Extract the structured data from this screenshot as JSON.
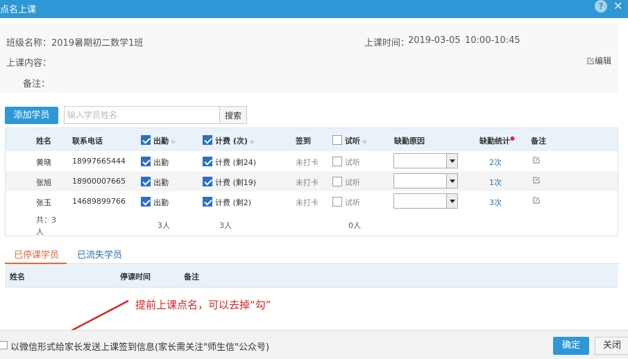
{
  "dialog": {
    "title": "点名上课",
    "help": "?",
    "close": "✕"
  },
  "info": {
    "class_label": "班级名称：",
    "class_name": "2019暑期初二数学1班",
    "time_label": "上课时间：",
    "date": "2019-03-05",
    "time": "10:00-10:45",
    "content_label": "上课内容：",
    "edit_label": "编辑",
    "note_label": "备注："
  },
  "toolbar": {
    "add_label": "添加学员",
    "search_placeholder": "输入学员姓名",
    "search_label": "搜索"
  },
  "table": {
    "headers": {
      "name": "姓名",
      "phone": "联系电话",
      "attend": "出勤",
      "charge": "计费 (次)",
      "sign": "签到",
      "trial": "试听",
      "reason": "缺勤原因",
      "absent": "缺勤统计",
      "note": "备注"
    },
    "rows": [
      {
        "name": "黄晓",
        "phone": "18997665444",
        "attend": "出勤",
        "attend_checked": true,
        "charge": "计费 (剩24)",
        "charge_checked": true,
        "sign": "未打卡",
        "trial": "试听",
        "trial_checked": false,
        "absent": "2次"
      },
      {
        "name": "张旭",
        "phone": "18900007665",
        "attend": "出勤",
        "attend_checked": true,
        "charge": "计费 (剩19)",
        "charge_checked": true,
        "sign": "未打卡",
        "trial": "试听",
        "trial_checked": false,
        "absent": "1次"
      },
      {
        "name": "张玉",
        "phone": "14689899766",
        "attend": "出勤",
        "attend_checked": true,
        "charge": "计费 (剩2)",
        "charge_checked": true,
        "sign": "未打卡",
        "trial": "试听",
        "trial_checked": false,
        "absent": "3次"
      }
    ],
    "summary": {
      "total_line1": "共：3",
      "total_line2": "人",
      "attend_count": "3人",
      "charge_count": "3人",
      "trial_count": "0人"
    }
  },
  "tabs": [
    {
      "label": "已停课学员"
    },
    {
      "label": "已流失学员"
    }
  ],
  "stopped_table": {
    "headers": {
      "name": "姓名",
      "stop_time": "停课时间",
      "note": "备注"
    }
  },
  "annotation": "提前上课点名，可以去掉“勾”",
  "footer": {
    "wechat_label": "以微信形式给家长发送上课签到信息(家长需关注\"师生信\"公众号)",
    "ok_label": "确定",
    "cancel_label": "关闭"
  },
  "colors": {
    "accent": "#2e97d6",
    "tab_active": "#e2683a",
    "annotation": "#e02020",
    "link": "#2a6fb4"
  }
}
